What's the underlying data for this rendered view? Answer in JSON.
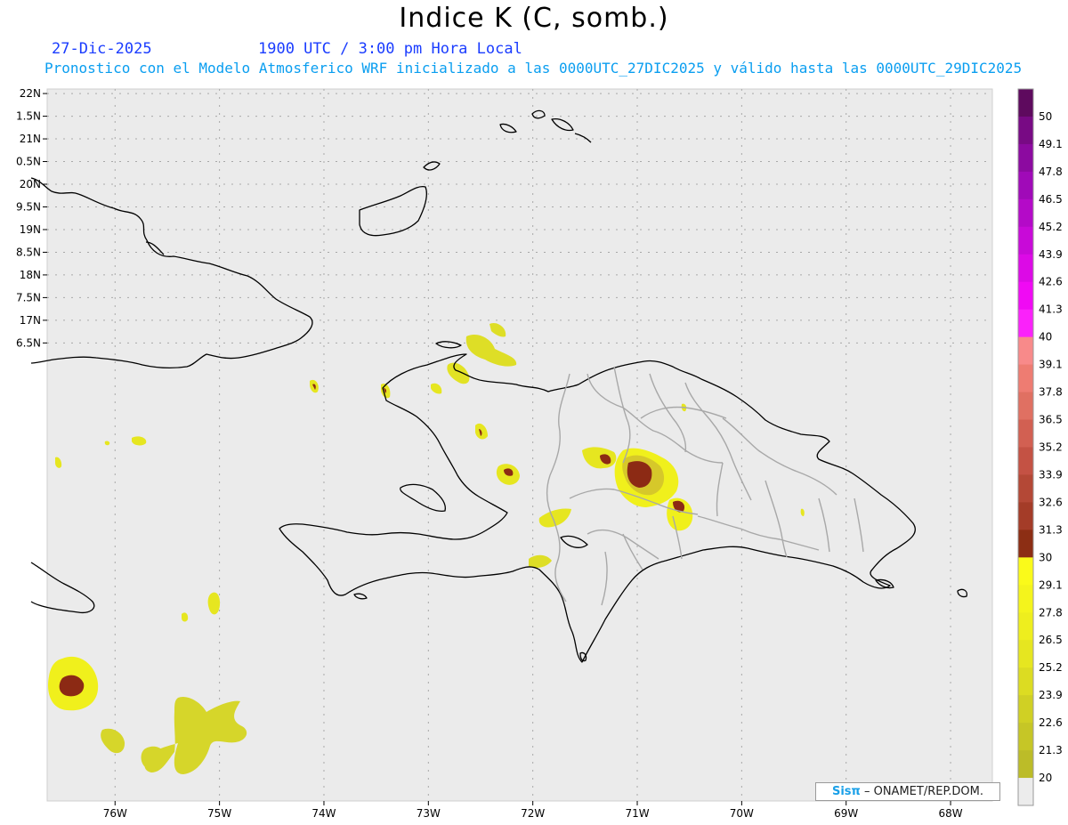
{
  "header": {
    "title": "Indice K (C, somb.)",
    "date": "27-Dic-2025",
    "time": "1900 UTC / 3:00 pm Hora Local",
    "subtitle": "Pronostico con el Modelo Atmosferico WRF inicializado a las 0000UTC_27DIC2025 y válido hasta las  0000UTC_29DIC2025"
  },
  "map": {
    "lon_range": [
      -76.65,
      -67.6
    ],
    "lat_range": [
      6.4,
      22.1
    ],
    "lat_ticks": [
      {
        "value": 22.0,
        "label": "22N"
      },
      {
        "value": 21.5,
        "label": "1.5N"
      },
      {
        "value": 21.0,
        "label": "21N"
      },
      {
        "value": 20.5,
        "label": "0.5N"
      },
      {
        "value": 20.0,
        "label": "20N"
      },
      {
        "value": 19.5,
        "label": "9.5N"
      },
      {
        "value": 19.0,
        "label": "19N"
      },
      {
        "value": 18.5,
        "label": "8.5N"
      },
      {
        "value": 18.0,
        "label": "18N"
      },
      {
        "value": 17.5,
        "label": "7.5N"
      },
      {
        "value": 17.0,
        "label": "17N"
      },
      {
        "value": 16.5,
        "label": "6.5N"
      }
    ],
    "lon_ticks": [
      {
        "value": -76,
        "label": "76W"
      },
      {
        "value": -75,
        "label": "75W"
      },
      {
        "value": -74,
        "label": "74W"
      },
      {
        "value": -73,
        "label": "73W"
      },
      {
        "value": -72,
        "label": "72W"
      },
      {
        "value": -71,
        "label": "71W"
      },
      {
        "value": -70,
        "label": "70W"
      },
      {
        "value": -69,
        "label": "69W"
      },
      {
        "value": -68,
        "label": "68W"
      }
    ],
    "colors": {
      "background": "#ebebeb",
      "grid": "#a8a8a8",
      "coast": "#000000",
      "provinces": "#a8a8a8",
      "k_low": "#f2f21c",
      "k_mid": "#d2d22a",
      "k_high": "#8c2a14"
    }
  },
  "colorbar": {
    "levels": [
      {
        "label": "50",
        "color": "#5e0a5e"
      },
      {
        "label": "49.1",
        "color": "#780a84"
      },
      {
        "label": "47.8",
        "color": "#8c0aa0"
      },
      {
        "label": "46.5",
        "color": "#a00ab8"
      },
      {
        "label": "45.2",
        "color": "#b40ac8"
      },
      {
        "label": "43.9",
        "color": "#c80ad8"
      },
      {
        "label": "42.6",
        "color": "#dc0ae6"
      },
      {
        "label": "41.3",
        "color": "#f00af4"
      },
      {
        "label": "40",
        "color": "#fa22fa"
      },
      {
        "label": "39.1",
        "color": "#f88a8a"
      },
      {
        "label": "37.8",
        "color": "#ee7c72"
      },
      {
        "label": "36.5",
        "color": "#e07062"
      },
      {
        "label": "35.2",
        "color": "#d26052"
      },
      {
        "label": "33.9",
        "color": "#c45244"
      },
      {
        "label": "32.6",
        "color": "#b44836"
      },
      {
        "label": "31.3",
        "color": "#a43c28"
      },
      {
        "label": "30",
        "color": "#8c2e14"
      },
      {
        "label": "29.1",
        "color": "#fafa1a"
      },
      {
        "label": "27.8",
        "color": "#f4f41c"
      },
      {
        "label": "26.5",
        "color": "#eeee1e"
      },
      {
        "label": "25.2",
        "color": "#e6e620"
      },
      {
        "label": "23.9",
        "color": "#dcdc22"
      },
      {
        "label": "22.6",
        "color": "#d0d024"
      },
      {
        "label": "21.3",
        "color": "#c6c626"
      },
      {
        "label": "20",
        "color": "#bcbc28"
      },
      {
        "label": "",
        "color": "#ececec"
      }
    ]
  },
  "credit": {
    "logo": "Sisπ",
    "text": "– ONAMET/REP.DOM."
  }
}
